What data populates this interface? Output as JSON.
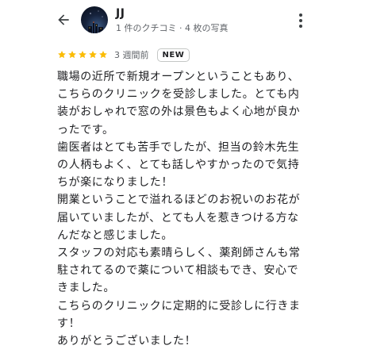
{
  "header": {
    "back_icon": "arrow-back-icon",
    "user_name": "JJ",
    "user_meta": "1 件のクチコミ · 4 枚の写真",
    "more_icon": "more-vert-icon"
  },
  "rating": {
    "stars": 5,
    "max_stars": 5,
    "star_color": "#fbbc04",
    "time_ago": "3 週間前",
    "badge": "NEW"
  },
  "review": {
    "paragraphs": [
      "職場の近所で新規オープンということもあり、こちらのクリニックを受診しました。とても内装がおしゃれで窓の外は景色もよく心地が良かったです。",
      "歯医者はとても苦手でしたが、担当の鈴木先生の人柄もよく、とても話しやすかったので気持ちが楽になりました！",
      "開業ということで溢れるほどのお祝いのお花が届いていましたが、とても人を惹きつける方なんだなと感じました。",
      "スタッフの対応も素晴らしく、薬剤師さんも常駐されてるので薬について相談もでき、安心できました。",
      "こちらのクリニックに定期的に受診しに行きます！",
      "ありがとうございました！"
    ]
  }
}
